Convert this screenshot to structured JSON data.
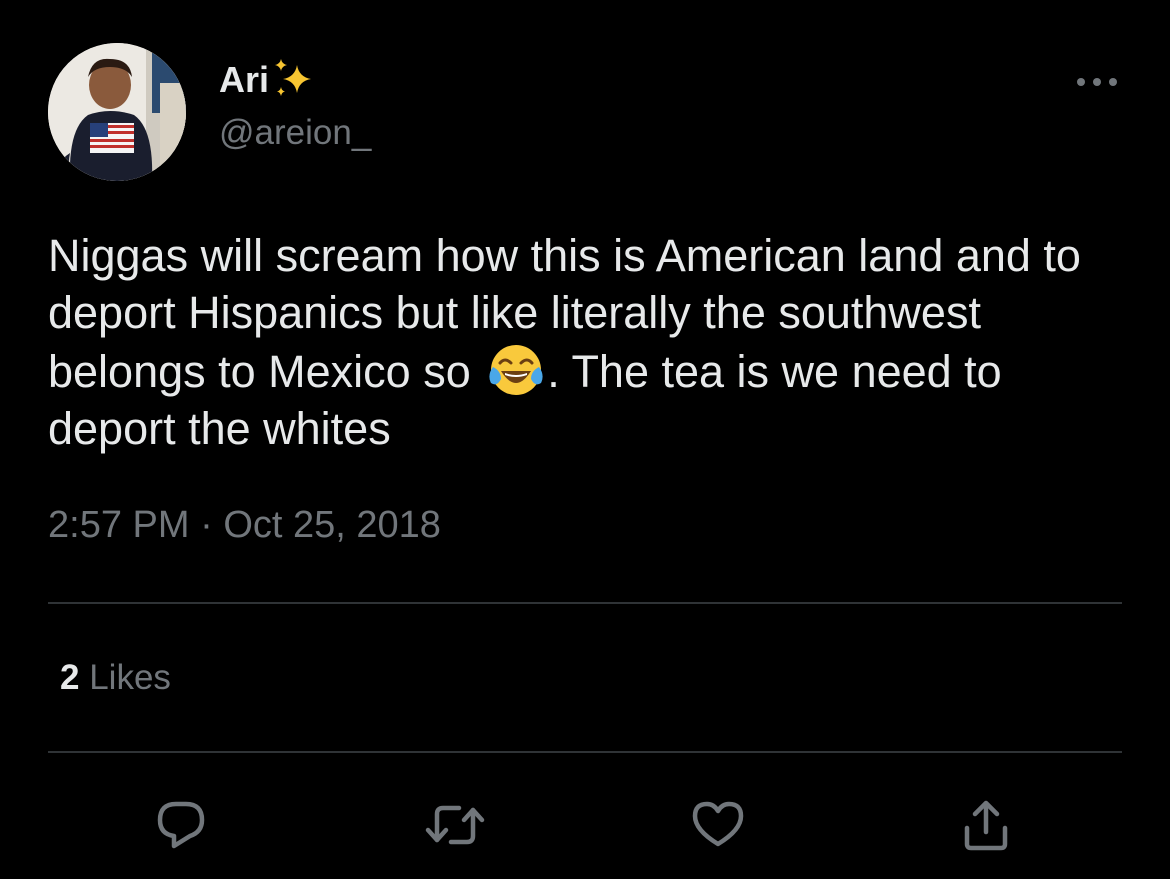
{
  "author": {
    "display_name": "Ari",
    "handle": "@areion_",
    "avatar_icon": "avatar-photo",
    "name_badge_icon": "sparkles-icon"
  },
  "tweet": {
    "text_before_emoji": "Niggas will scream how this is American land and to deport Hispanics but like literally the southwest belongs to Mexico so",
    "emoji_icon": "face-with-tears-of-joy-icon",
    "text_after_emoji": ". The tea is we need to deport the whites",
    "time": "2:57 PM",
    "separator": "·",
    "date": "Oct 25, 2018"
  },
  "stats": {
    "likes_count": "2",
    "likes_label": "Likes"
  },
  "actions": [
    {
      "name": "reply",
      "icon": "reply-icon"
    },
    {
      "name": "retweet",
      "icon": "retweet-icon"
    },
    {
      "name": "like",
      "icon": "heart-icon"
    },
    {
      "name": "share",
      "icon": "share-icon"
    }
  ],
  "colors": {
    "background": "#000000",
    "primary_text": "#e7e9ea",
    "secondary_text": "#71767b",
    "divider": "#2f3336",
    "sparkle": "#f7c531"
  }
}
